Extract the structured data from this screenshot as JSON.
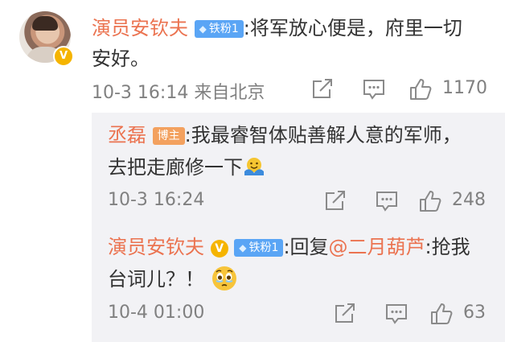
{
  "comment": {
    "author": "演员安钦夫",
    "badge": "铁粉1",
    "text_line1": ":将军放心便是，府里一切",
    "text_line2": "安好。",
    "time": "10-3 16:14 来自北京",
    "likes": "1170"
  },
  "replies": [
    {
      "author": "丞磊",
      "badge": "博主",
      "text_line1": ":我最睿智体贴善解人意的军师，",
      "text_line2": "去把走廊修一下",
      "time": "10-3 16:24",
      "likes": "248"
    },
    {
      "author": "演员安钦夫",
      "badge": "铁粉1",
      "reply_prefix": ":回复",
      "mention": "@二月葫芦",
      "text_line1": ":抢我",
      "text_line2": "台词儿？！",
      "time": "10-4 01:00",
      "likes": "63"
    }
  ],
  "verified_mark": "V",
  "colors": {
    "name": "#eb7350",
    "text": "#333333",
    "meta": "#808080",
    "reply_bg": "#f2f2f5",
    "tie_badge": "#5aa5f5",
    "blogger_badge": "#f3a15f",
    "verified": "#f5b400"
  }
}
